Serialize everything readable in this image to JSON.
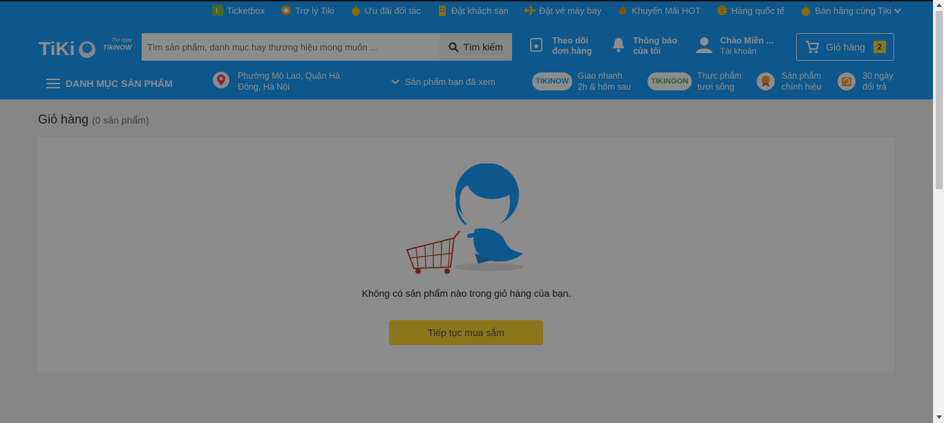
{
  "topbar": {
    "links": [
      {
        "label": "Ticketbox",
        "icon": "ticketbox-icon"
      },
      {
        "label": "Trợ lý Tiki",
        "icon": "assistant-icon"
      },
      {
        "label": "Ưu đãi đối tác",
        "icon": "moneybag-icon"
      },
      {
        "label": "Đặt khách sạn",
        "icon": "hotel-icon"
      },
      {
        "label": "Đặt vé máy bay",
        "icon": "airplane-icon"
      },
      {
        "label": "Khuyến Mãi HOT",
        "icon": "fire-icon"
      },
      {
        "label": "Hàng quốc tế",
        "icon": "globe-icon"
      },
      {
        "label": "Bán hàng cùng Tiki",
        "icon": "moneybag-icon"
      }
    ]
  },
  "header": {
    "logo": {
      "brand": "TiKi",
      "tag_small": "Thử ngay",
      "tag_big": "TikiNOW"
    },
    "search": {
      "placeholder": "Tìm sản phẩm, danh mục hay thương hiệu mong muốn ...",
      "button": "Tìm kiếm"
    },
    "track": {
      "line1": "Theo dõi",
      "line2": "đơn hàng"
    },
    "notify": {
      "line1": "Thông báo",
      "line2": "của tôi"
    },
    "account": {
      "line1": "Chào Miền ...",
      "line2": "Tài khoản"
    },
    "cart": {
      "label": "Giỏ hàng",
      "count": "2"
    }
  },
  "subnav": {
    "menu": "DANH MỤC SẢN PHẨM",
    "location": {
      "line1": "Phường Mộ Lao, Quận Hà",
      "line2": "Đông, Hà Nội"
    },
    "viewed": "Sản phẩm bạn đã xem",
    "promos": [
      {
        "badge": "TIKINOW",
        "line1": "Giao nhanh",
        "line2": "2h & hôm sau"
      },
      {
        "badge": "TIKINGON",
        "line1": "Thực phẩm",
        "line2": "tươi sống"
      },
      {
        "badge": "",
        "line1": "Sản phẩm",
        "line2": "chính hiệu"
      },
      {
        "badge": "",
        "line1": "30 ngày",
        "line2": "đổi trả"
      }
    ]
  },
  "page": {
    "title": "Giỏ hàng",
    "count_text": "(0 sản phẩm)",
    "empty_message": "Không có sản phẩm nào trong giỏ hàng của bạn.",
    "continue_button": "Tiếp tục mua sắm"
  },
  "colors": {
    "brand_blue": "#189eff",
    "accent_yellow": "#fdd835"
  }
}
